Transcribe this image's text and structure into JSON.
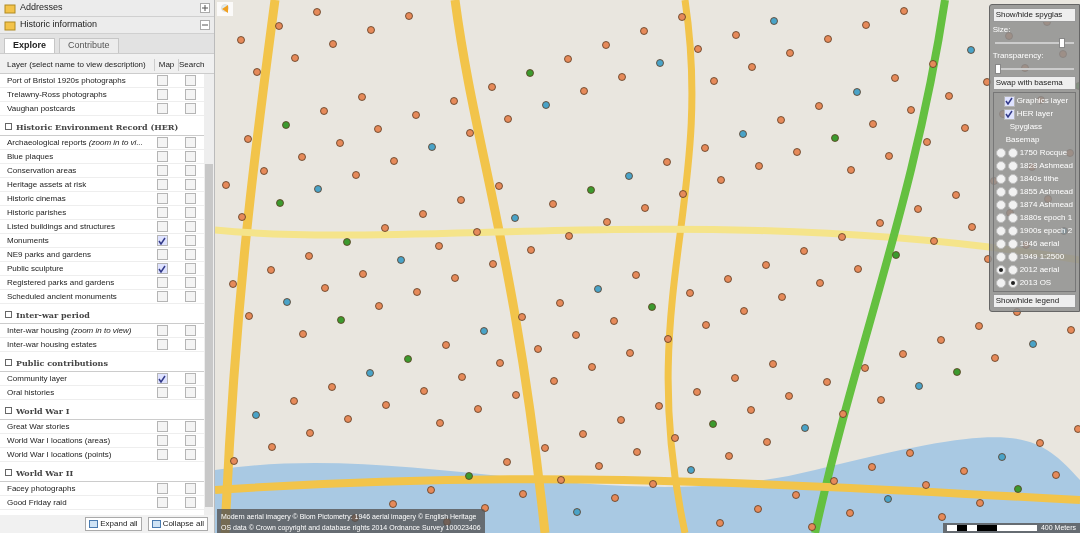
{
  "accordion": [
    {
      "label": "Addresses",
      "expanded": false
    },
    {
      "label": "Historic information",
      "expanded": true
    }
  ],
  "tabs": [
    {
      "label": "Explore",
      "selected": true
    },
    {
      "label": "Contribute",
      "selected": false
    }
  ],
  "table": {
    "columns": [
      "Layer (select name to view description)",
      "Map",
      "Search"
    ],
    "sections": [
      {
        "rows": [
          {
            "name": "Port of Bristol 1920s photographs",
            "map": false,
            "search": false
          },
          {
            "name": "Trelawny-Ross photographs",
            "map": false,
            "search": false
          },
          {
            "name": "Vaughan postcards",
            "map": false,
            "search": false
          }
        ]
      },
      {
        "title": "Historic Environment Record (HER)",
        "rows": [
          {
            "name": "Archaeological reports *(zoom in to vi...*",
            "map": false,
            "search": false
          },
          {
            "name": "Blue plaques",
            "map": false,
            "search": false
          },
          {
            "name": "Conservation areas",
            "map": false,
            "search": false
          },
          {
            "name": "Heritage assets at risk",
            "map": false,
            "search": false
          },
          {
            "name": "Historic cinemas",
            "map": false,
            "search": false
          },
          {
            "name": "Historic parishes",
            "map": false,
            "search": false
          },
          {
            "name": "Listed buildings and structures",
            "map": false,
            "search": false
          },
          {
            "name": "Monuments",
            "map": true,
            "search": false
          },
          {
            "name": "NE9 parks and gardens",
            "map": false,
            "search": false
          },
          {
            "name": "Public sculpture",
            "map": true,
            "search": false
          },
          {
            "name": "Registered parks and gardens",
            "map": false,
            "search": false
          },
          {
            "name": "Scheduled ancient monuments",
            "map": false,
            "search": false
          }
        ]
      },
      {
        "title": "Inter-war period",
        "rows": [
          {
            "name": "Inter-war housing *(zoom in to view)*",
            "map": false,
            "search": false
          },
          {
            "name": "Inter-war housing estates",
            "map": false,
            "search": false
          }
        ]
      },
      {
        "title": "Public contributions",
        "rows": [
          {
            "name": "Community layer",
            "map": true,
            "search": false
          },
          {
            "name": "Oral histories",
            "map": false,
            "search": false
          }
        ]
      },
      {
        "title": "World War I",
        "rows": [
          {
            "name": "Great War stories",
            "map": false,
            "search": false
          },
          {
            "name": "World War I locations (areas)",
            "map": false,
            "search": false
          },
          {
            "name": "World War I locations (points)",
            "map": false,
            "search": false
          }
        ]
      },
      {
        "title": "World War II",
        "rows": [
          {
            "name": "Facey photographs",
            "map": false,
            "search": false
          },
          {
            "name": "Good Friday raid",
            "map": false,
            "search": false
          }
        ]
      }
    ]
  },
  "footer_buttons": [
    "Expand all",
    "Collapse all"
  ],
  "spyglass": {
    "toggle": "Show/hide spyglas",
    "size_label": "Size:",
    "size": {
      "level": 0.85
    },
    "transparency_label": "Transparency:",
    "transparency": {
      "level": 0.0
    },
    "swap": "Swap with basema",
    "checks": [
      {
        "label": "Graphics layer",
        "checked": true
      },
      {
        "label": "HER layer",
        "checked": true
      }
    ],
    "column_labels": [
      "Spyglass",
      "Basemap"
    ],
    "layers": [
      {
        "label": "1750 Rocque",
        "spyglass": false,
        "basemap": false
      },
      {
        "label": "1828 Ashmead",
        "spyglass": false,
        "basemap": false
      },
      {
        "label": "1840s tithe",
        "spyglass": false,
        "basemap": false
      },
      {
        "label": "1855 Ashmead",
        "spyglass": false,
        "basemap": false
      },
      {
        "label": "1874 Ashmead",
        "spyglass": false,
        "basemap": false
      },
      {
        "label": "1880s epoch 1",
        "spyglass": false,
        "basemap": false
      },
      {
        "label": "1900s epoch 2",
        "spyglass": false,
        "basemap": false
      },
      {
        "label": "1946 aerial",
        "spyglass": false,
        "basemap": false
      },
      {
        "label": "1949 1:2500",
        "spyglass": false,
        "basemap": false
      },
      {
        "label": "2012 aerial",
        "spyglass": true,
        "basemap": false
      },
      {
        "label": "2013 OS",
        "spyglass": false,
        "basemap": true
      }
    ],
    "legend": "Show/hide legend"
  },
  "attribution": [
    "Modern aerial imagery © Blom Pictometry: 1946 aerial imagery © English Heritage",
    "OS data © Crown copyright and database rights 2014 Ordnance Survey 100023406"
  ],
  "scale": "400 Meters"
}
